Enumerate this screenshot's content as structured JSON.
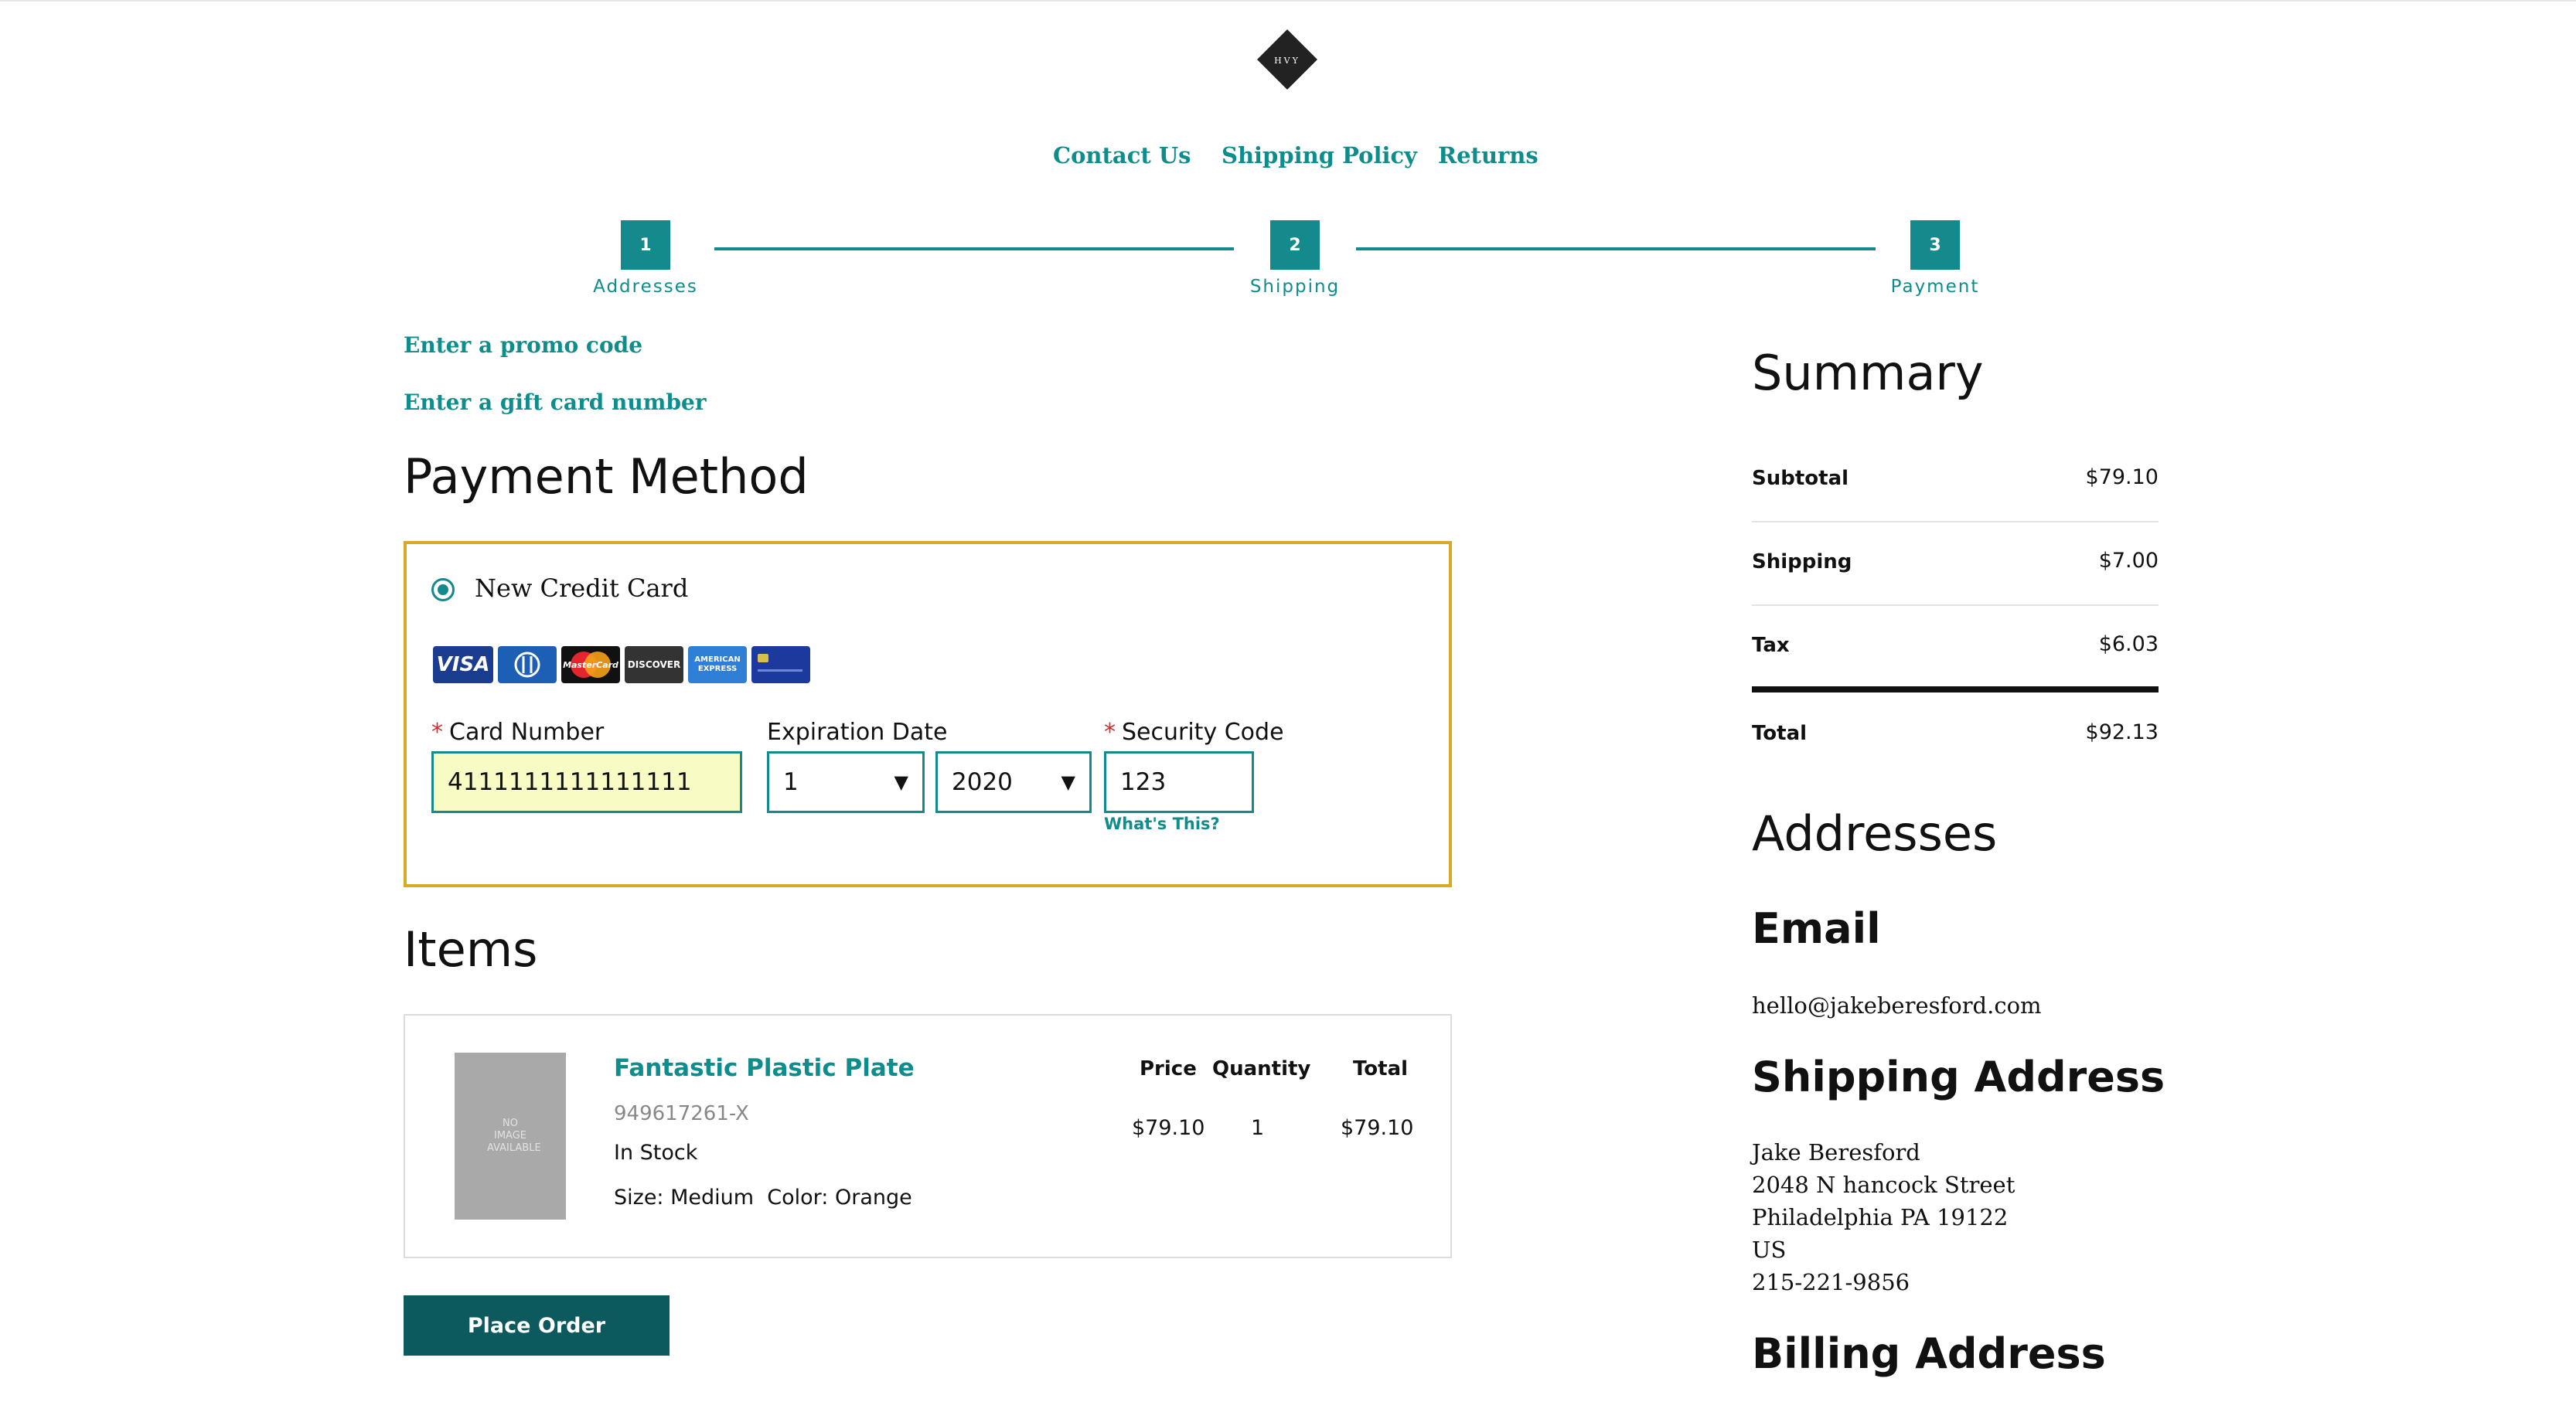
{
  "logo": {
    "text": "HVY",
    "icon": "diamond-logo"
  },
  "nav": [
    {
      "label": "Contact Us"
    },
    {
      "label": "Shipping Policy"
    },
    {
      "label": "Returns"
    }
  ],
  "steps": [
    {
      "number": "1",
      "label": "Addresses"
    },
    {
      "number": "2",
      "label": "Shipping"
    },
    {
      "number": "3",
      "label": "Payment"
    }
  ],
  "promo": {
    "promo_link": "Enter a promo code",
    "gift_link": "Enter a gift card number"
  },
  "payment": {
    "heading": "Payment Method",
    "option_label": "New Credit Card",
    "card_logos": [
      {
        "name": "visa",
        "text": "VISA"
      },
      {
        "name": "diners",
        "text": ""
      },
      {
        "name": "mastercard",
        "text": "MasterCard"
      },
      {
        "name": "discover",
        "text": "DISCOVER"
      },
      {
        "name": "amex",
        "text": "AMERICAN EXPRESS"
      },
      {
        "name": "generic-card",
        "text": ""
      }
    ],
    "card_number_label": "Card Number",
    "card_number_value": "4111111111111111",
    "expiration_label": "Expiration Date",
    "exp_month": "1",
    "exp_year": "2020",
    "security_label": "Security Code",
    "security_value": "123",
    "whats_this": "What's This?",
    "colors": {
      "accent": "#148a8c",
      "highlight_border": "#d9a928",
      "input_fill": "#f8fcc4"
    }
  },
  "items": {
    "heading": "Items",
    "image_text": "NO IMAGE AVAILABLE",
    "columns": {
      "price": "Price",
      "quantity": "Quantity",
      "total": "Total"
    },
    "list": [
      {
        "name": "Fantastic Plastic Plate",
        "sku": "949617261-X",
        "stock": "In Stock",
        "size_label": "Size:",
        "size": "Medium",
        "color_label": "Color:",
        "color": "Orange",
        "price": "$79.10",
        "quantity": "1",
        "total": "$79.10"
      }
    ]
  },
  "place_order": "Place Order",
  "summary": {
    "heading": "Summary",
    "rows": [
      {
        "label": "Subtotal",
        "value": "$79.10"
      },
      {
        "label": "Shipping",
        "value": "$7.00"
      },
      {
        "label": "Tax",
        "value": "$6.03"
      }
    ],
    "total_label": "Total",
    "total_value": "$92.13"
  },
  "addresses": {
    "heading": "Addresses",
    "email_heading": "Email",
    "email": "hello@jakeberesford.com",
    "shipping_heading": "Shipping Address",
    "shipping_lines": [
      "Jake Beresford",
      "2048 N hancock Street",
      "Philadelphia PA 19122",
      "US",
      "215-221-9856"
    ],
    "billing_heading": "Billing Address"
  }
}
